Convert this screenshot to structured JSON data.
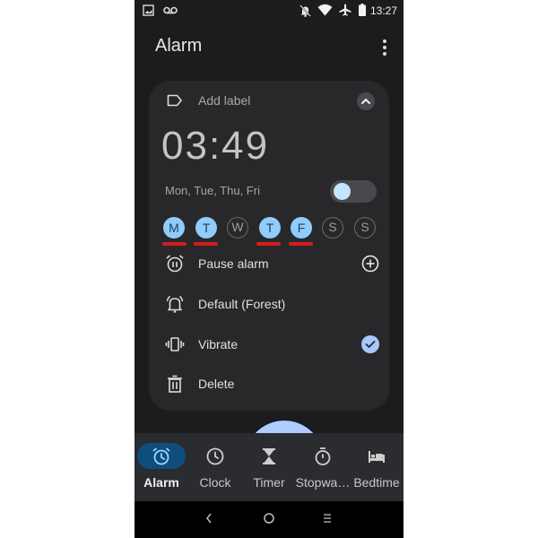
{
  "status_bar": {
    "time": "13:27",
    "left_icons": [
      "image-icon",
      "voicemail-icon"
    ],
    "right_icons": [
      "bell-off-icon",
      "wifi-icon",
      "airplane-mode-icon",
      "battery-icon"
    ]
  },
  "app_bar": {
    "title": "Alarm",
    "menu_icon": "more-vert-icon"
  },
  "alarm_card": {
    "label_placeholder": "Add label",
    "time": "03:49",
    "repeat_summary": "Mon, Tue, Thu, Fri",
    "enabled": false,
    "days": [
      {
        "letter": "M",
        "selected": true,
        "underlined": true
      },
      {
        "letter": "T",
        "selected": true,
        "underlined": true
      },
      {
        "letter": "W",
        "selected": false,
        "underlined": false
      },
      {
        "letter": "T",
        "selected": true,
        "underlined": true
      },
      {
        "letter": "F",
        "selected": true,
        "underlined": true
      },
      {
        "letter": "S",
        "selected": false,
        "underlined": false
      },
      {
        "letter": "S",
        "selected": false,
        "underlined": false
      }
    ],
    "options": [
      {
        "label": "Pause alarm",
        "icon": "alarm-pause-icon",
        "action_icon": "add-circle-icon"
      },
      {
        "label": "Default (Forest)",
        "icon": "bell-icon"
      },
      {
        "label": "Vibrate",
        "icon": "vibrate-icon",
        "checked": true
      },
      {
        "label": "Delete",
        "icon": "trash-icon"
      }
    ]
  },
  "fab": {
    "icon": "plus-icon"
  },
  "bottom_nav": {
    "active": "Alarm",
    "tabs": [
      {
        "label": "Alarm",
        "icon": "alarm-icon"
      },
      {
        "label": "Clock",
        "icon": "clock-icon"
      },
      {
        "label": "Timer",
        "icon": "hourglass-icon"
      },
      {
        "label": "Stopwa…",
        "icon": "stopwatch-icon"
      },
      {
        "label": "Bedtime",
        "icon": "bed-icon"
      }
    ]
  },
  "system_nav": [
    "back-icon",
    "home-icon",
    "recents-icon"
  ],
  "colors": {
    "background": "#1c1c1e",
    "card": "#28282b",
    "accent_day": "#8fcdfc",
    "fab": "#b1cdff",
    "active_tab_pill": "#0d4e7d",
    "annotation_underline": "#d31d1d"
  }
}
